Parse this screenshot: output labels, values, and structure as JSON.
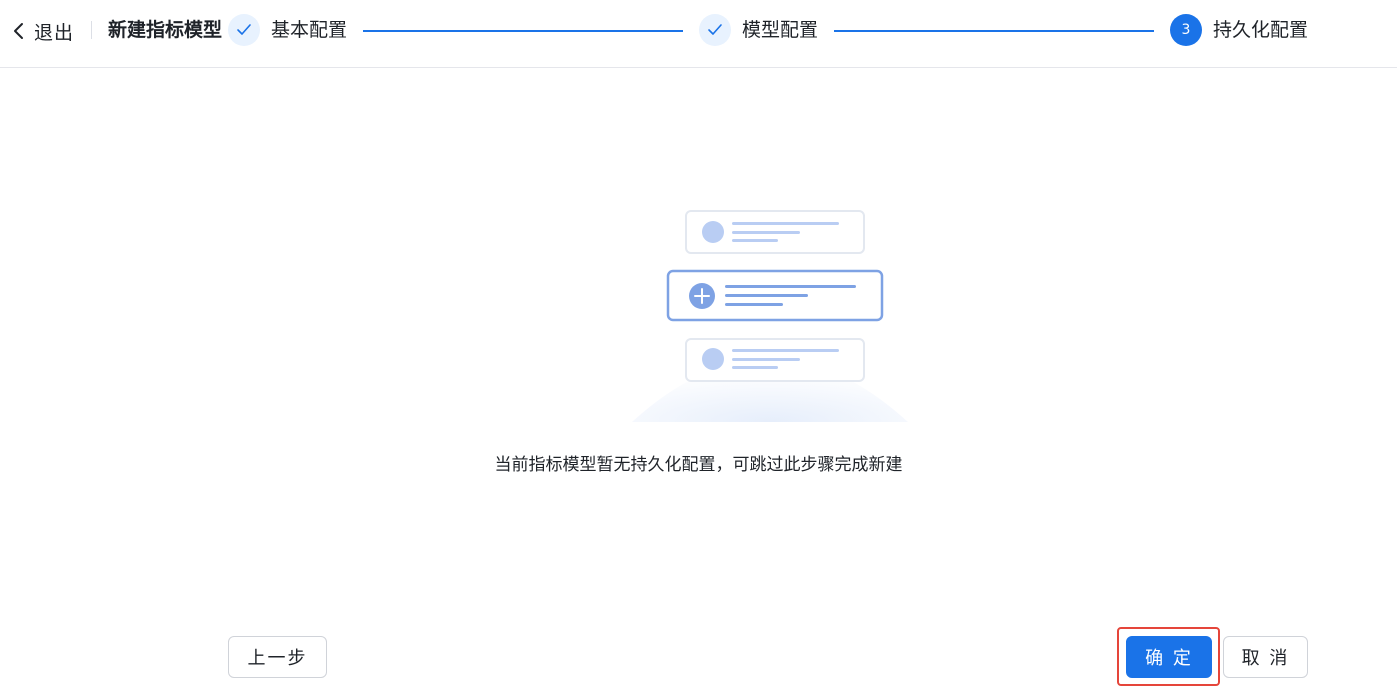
{
  "header": {
    "back_label": "退出",
    "title": "新建指标模型",
    "steps": [
      {
        "index": "1",
        "label": "基本配置",
        "status": "done"
      },
      {
        "index": "2",
        "label": "模型配置",
        "status": "done"
      },
      {
        "index": "3",
        "label": "持久化配置",
        "status": "current"
      }
    ]
  },
  "empty_state": {
    "message": "当前指标模型暂无持久化配置，可跳过此步骤完成新建",
    "icon": "empty-list-illustration"
  },
  "footer": {
    "prev_label": "上一步",
    "confirm_label": "确 定",
    "cancel_label": "取 消"
  },
  "colors": {
    "primary": "#1a73e8",
    "step_done_bg": "#e8f2fe",
    "highlight": "#e5453a"
  }
}
